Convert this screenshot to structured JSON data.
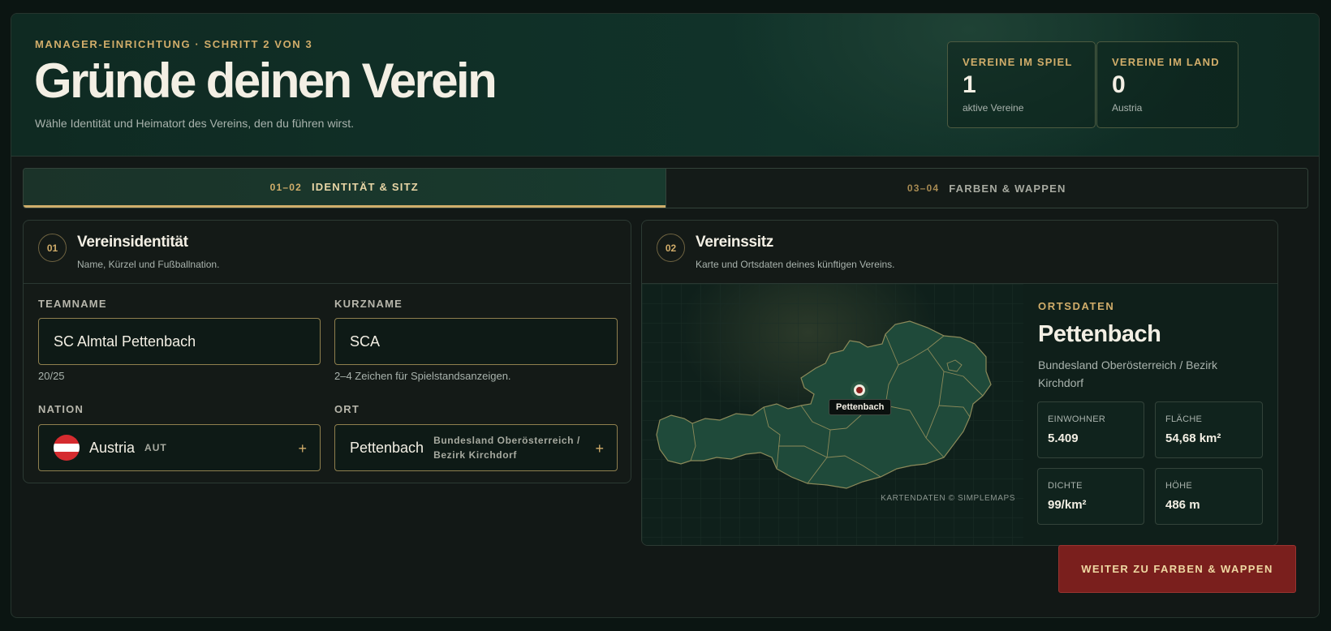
{
  "header": {
    "eyebrow": "MANAGER-EINRICHTUNG · SCHRITT 2 VON 3",
    "title": "Gründe deinen Verein",
    "subtitle": "Wähle Identität und Heimatort des Vereins, den du führen wirst."
  },
  "stats": [
    {
      "label": "VEREINE IM SPIEL",
      "value": "1",
      "caption": "aktive Vereine"
    },
    {
      "label": "VEREINE IM LAND",
      "value": "0",
      "caption": "Austria"
    }
  ],
  "tabs": [
    {
      "num": "01–02",
      "label": "IDENTITÄT & SITZ",
      "active": true
    },
    {
      "num": "03–04",
      "label": "FARBEN & WAPPEN",
      "active": false
    }
  ],
  "identity": {
    "badge": "01",
    "title": "Vereinsidentität",
    "subtitle": "Name, Kürzel und Fußballnation.",
    "team_label": "TEAMNAME",
    "team_value": "SC Almtal Pettenbach",
    "team_counter": "20/25",
    "short_label": "KURZNAME",
    "short_value": "SCA",
    "short_hint": "2–4 Zeichen für Spielstandsanzeigen.",
    "nation_label": "NATION",
    "nation_value": "Austria",
    "nation_code": "AUT",
    "nation_flag_colors": [
      "#d52b2f",
      "#ffffff",
      "#d52b2f"
    ],
    "ort_label": "ORT",
    "ort_value": "Pettenbach",
    "ort_region": "Bundesland Oberösterreich / Bezirk Kirchdorf",
    "plus_icon": "+"
  },
  "seat": {
    "badge": "02",
    "title": "Vereinssitz",
    "subtitle": "Karte und Ortsdaten deines künftigen Vereins.",
    "map_pin_label": "Pettenbach",
    "map_credit": "KARTENDATEN © SIMPLEMAPS",
    "ort_eyebrow": "ORTSDATEN",
    "ort_name": "Pettenbach",
    "ort_region": "Bundesland Oberösterreich / Bezirk Kirchdorf",
    "facts": [
      {
        "label": "EINWOHNER",
        "value": "5.409"
      },
      {
        "label": "FLÄCHE",
        "value": "54,68 km²"
      },
      {
        "label": "DICHTE",
        "value": "99/km²"
      },
      {
        "label": "HÖHE",
        "value": "486 m"
      }
    ]
  },
  "cta": {
    "label": "WEITER ZU FARBEN & WAPPEN"
  },
  "colors": {
    "accent_gold": "#d1ad6a",
    "cta_red": "#7a1f1d",
    "map_fill": "#1f4a3a"
  }
}
